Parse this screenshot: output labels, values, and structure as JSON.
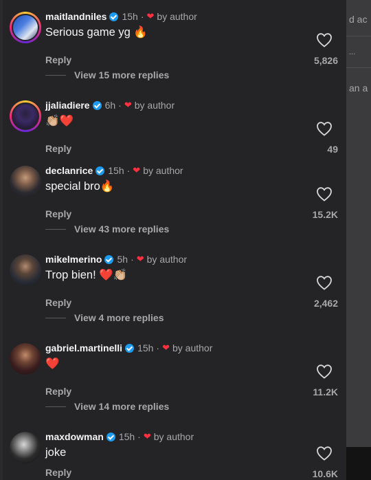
{
  "background_fragments": [
    "d ac",
    "...",
    "an a"
  ],
  "comments": [
    {
      "username": "maitlandniles",
      "time": "15h",
      "by_author": "by author",
      "text": "Serious game yg",
      "emoji": "🔥",
      "reply_label": "Reply",
      "likes": "5,826",
      "view_replies": "View 15 more replies"
    },
    {
      "username": "jjaliadiere",
      "time": "6h",
      "by_author": "by author",
      "text": "",
      "emoji": "👏🏼❤️",
      "reply_label": "Reply",
      "likes": "49"
    },
    {
      "username": "declanrice",
      "time": "15h",
      "by_author": "by author",
      "text": "special bro",
      "emoji": "🔥",
      "reply_label": "Reply",
      "likes": "15.2K",
      "view_replies": "View 43 more replies"
    },
    {
      "username": "mikelmerino",
      "time": "5h",
      "by_author": "by author",
      "text": "Trop bien!",
      "emoji": "❤️👏🏼",
      "reply_label": "Reply",
      "likes": "2,462",
      "view_replies": "View 4 more replies"
    },
    {
      "username": "gabriel.martinelli",
      "time": "15h",
      "by_author": "by author",
      "text": "",
      "emoji": "❤️",
      "reply_label": "Reply",
      "likes": "11.2K",
      "view_replies": "View 14 more replies"
    },
    {
      "username": "maxdowman",
      "time": "15h",
      "by_author": "by author",
      "text": "joke",
      "emoji": "",
      "reply_label": "Reply",
      "likes": "10.6K"
    }
  ],
  "icons": {
    "like": "heart-outline-icon",
    "verified": "verified-badge-icon",
    "author_like": "red-heart-icon"
  },
  "colors": {
    "panel_bg": "#242426",
    "text_primary": "#f5f5f5",
    "text_secondary": "#a8a8aa",
    "verified": "#1d9bf0",
    "heart_red": "#ff3040"
  }
}
